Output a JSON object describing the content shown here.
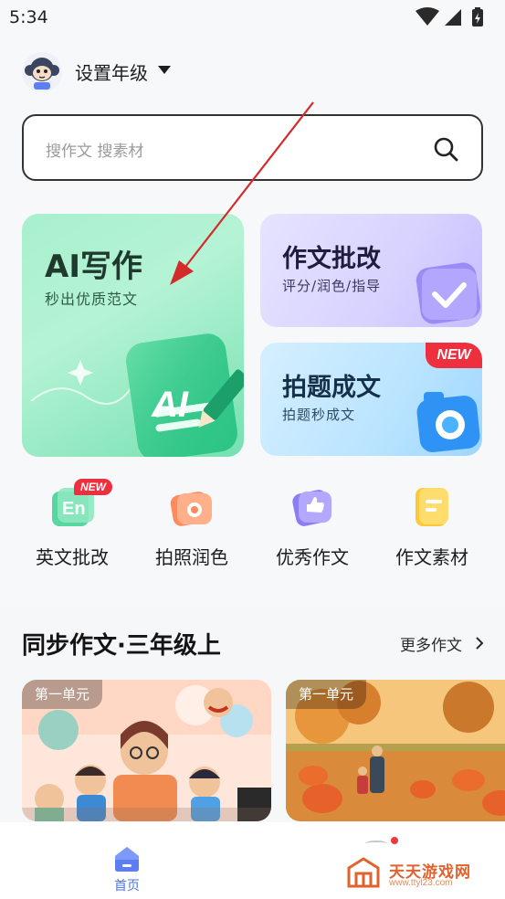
{
  "status_bar": {
    "time": "5:34"
  },
  "header": {
    "grade_selector": "设置年级"
  },
  "search": {
    "placeholder": "搜作文 搜素材"
  },
  "cards": {
    "ai_writing": {
      "title": "AI写作",
      "subtitle": "秒出优质范文",
      "art_text": "AI"
    },
    "essay_correction": {
      "title": "作文批改",
      "subtitle": "评分/润色/指导"
    },
    "photo_essay": {
      "title": "拍题成文",
      "subtitle": "拍题秒成文",
      "badge": "NEW"
    }
  },
  "tools": [
    {
      "label": "英文批改",
      "icon": "en-icon",
      "badge": "NEW",
      "icon_text": "En"
    },
    {
      "label": "拍照润色",
      "icon": "camera-icon"
    },
    {
      "label": "优秀作文",
      "icon": "thumbs-up-icon"
    },
    {
      "label": "作文素材",
      "icon": "notes-icon"
    }
  ],
  "section": {
    "title": "同步作文·三年级上",
    "more_label": "更多作文",
    "items": [
      {
        "tag": "第一单元"
      },
      {
        "tag": "第一单元"
      }
    ]
  },
  "bottom_nav": {
    "home_label": "首页"
  },
  "watermark": {
    "brand": "天天游戏网",
    "url": "www.ttyl23.com"
  },
  "colors": {
    "accent": "#4a73f0",
    "badge_red": "#ee2f3d",
    "ai_card": "#a7f0cd",
    "correction_card": "#d7d2ff",
    "photo_card": "#b9e4ff",
    "annotation_arrow": "#d32a2a"
  }
}
